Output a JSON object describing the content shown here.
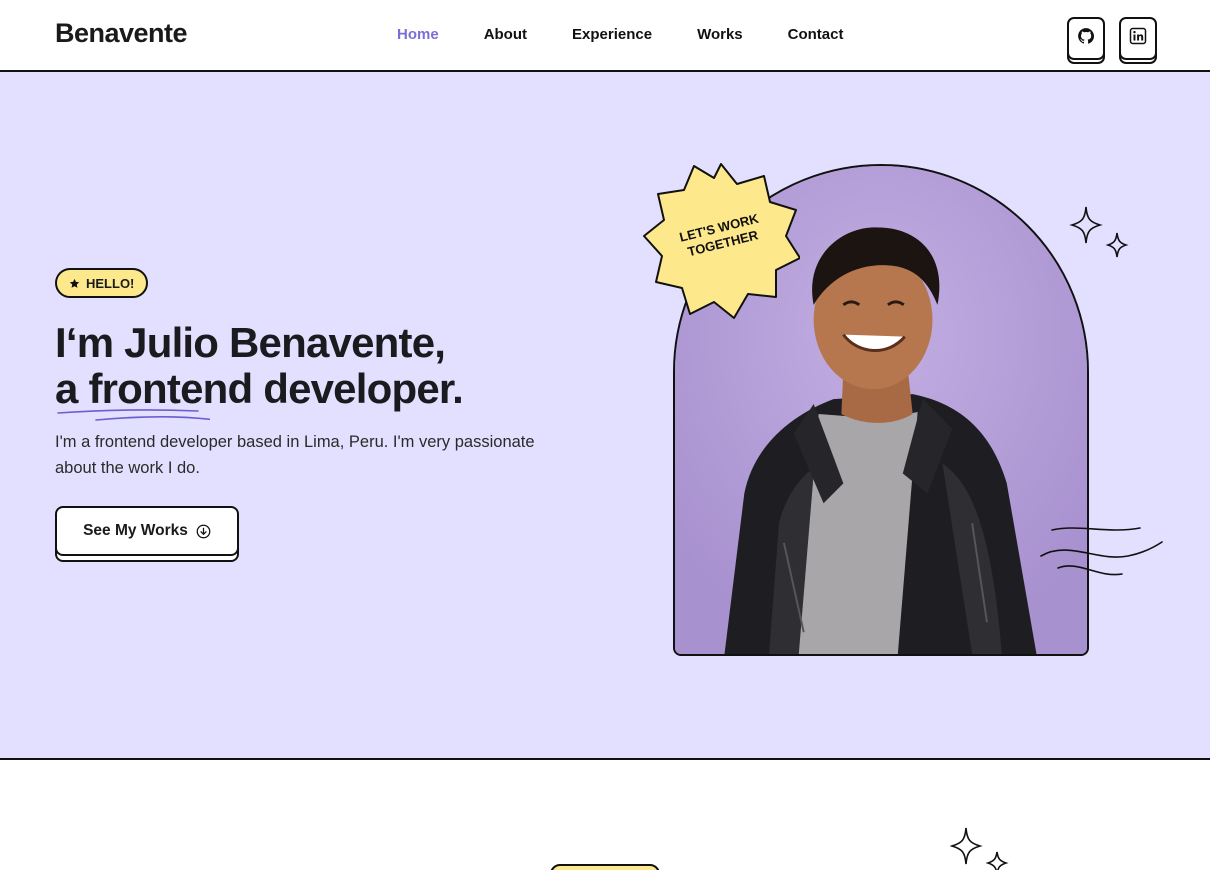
{
  "brand": {
    "name": "Benavente"
  },
  "nav": {
    "items": [
      {
        "label": "Home",
        "active": true
      },
      {
        "label": "About",
        "active": false
      },
      {
        "label": "Experience",
        "active": false
      },
      {
        "label": "Works",
        "active": false
      },
      {
        "label": "Contact",
        "active": false
      }
    ],
    "socials": [
      {
        "icon": "github-icon"
      },
      {
        "icon": "linkedin-icon"
      }
    ]
  },
  "hero": {
    "badge": "HELLO!",
    "headline_line1": "I‘m Julio Benavente,",
    "headline_a": "a ",
    "headline_highlight": "frontend",
    "headline_rest": " developer.",
    "intro": "I'm a frontend developer based in Lima, Peru. I'm very passionate about the work I do.",
    "cta": "See My Works",
    "sticker_line1": "LET'S WORK",
    "sticker_line2": "TOGETHER"
  },
  "colors": {
    "accent": "#7b6fd6",
    "hero_bg": "#e2e0fe",
    "arch_bg": "#b09bd4",
    "yellow": "#fde98b",
    "ink": "#111111"
  }
}
